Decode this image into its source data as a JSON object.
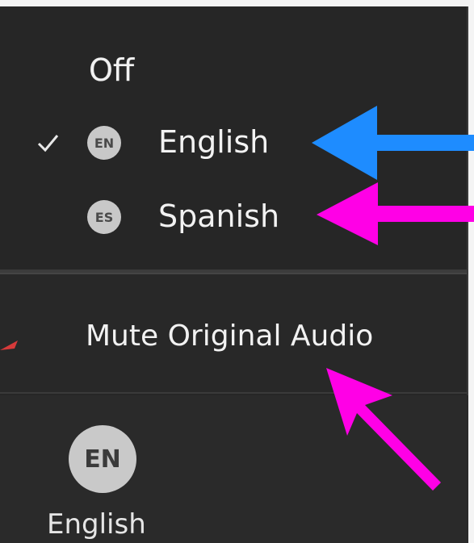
{
  "menu": {
    "off_label": "Off",
    "languages": [
      {
        "code": "EN",
        "label": "English",
        "checked": true
      },
      {
        "code": "ES",
        "label": "Spanish",
        "checked": false
      }
    ],
    "mute_label": "Mute Original Audio"
  },
  "footer": {
    "badge_code": "EN",
    "label": "English"
  },
  "colors": {
    "menu_bg": "#262626",
    "text": "#f2f2f2",
    "badge_bg": "#c8c8c8",
    "arrow_blue": "#1e8cff",
    "arrow_magenta": "#ff00e6"
  },
  "icons": {
    "check": "checkmark-icon",
    "arrow_blue": "blue-arrow-annotation",
    "arrow_magenta": "magenta-arrow-annotation"
  }
}
